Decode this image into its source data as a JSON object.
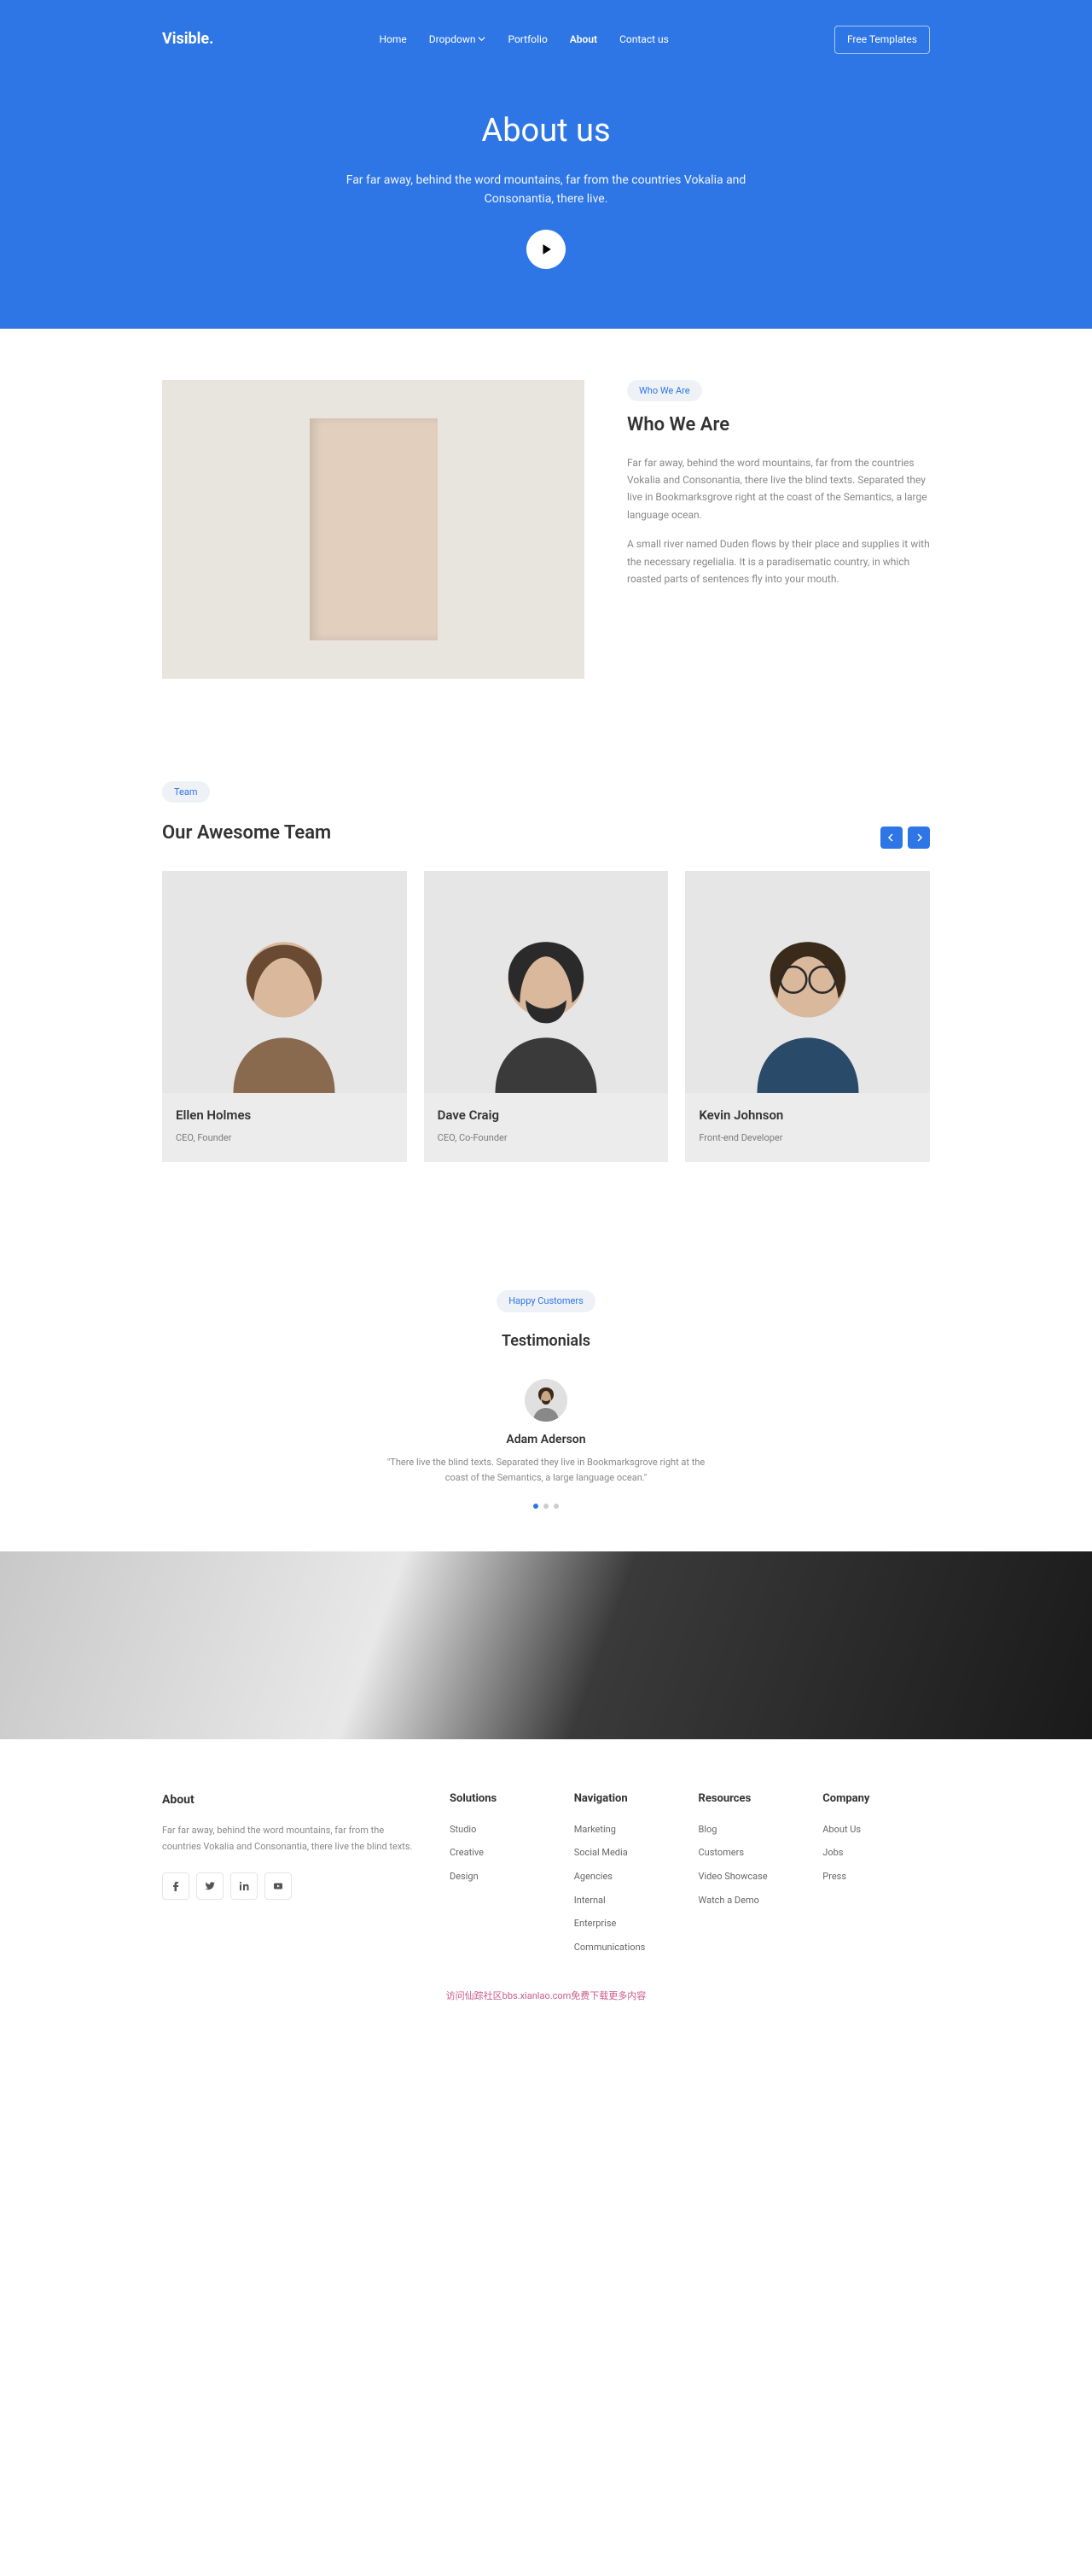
{
  "nav": {
    "logo": "Visible.",
    "items": [
      "Home",
      "Dropdown",
      "Portfolio",
      "About",
      "Contact us"
    ],
    "free": "Free Templates"
  },
  "hero": {
    "title": "About us",
    "subtitle": "Far far away, behind the word mountains, far from the countries Vokalia and Consonantia, there live."
  },
  "who": {
    "pill": "Who We Are",
    "title": "Who We Are",
    "p1": "Far far away, behind the word mountains, far from the countries Vokalia and Consonantia, there live the blind texts. Separated they live in Bookmarksgrove right at the coast of the Semantics, a large language ocean.",
    "p2": "A small river named Duden flows by their place and supplies it with the necessary regelialia. It is a paradisematic country, in which roasted parts of sentences fly into your mouth."
  },
  "team": {
    "pill": "Team",
    "title": "Our Awesome Team",
    "members": [
      {
        "name": "Ellen Holmes",
        "role": "CEO, Founder"
      },
      {
        "name": "Dave Craig",
        "role": "CEO, Co-Founder"
      },
      {
        "name": "Kevin Johnson",
        "role": "Front-end Developer"
      }
    ]
  },
  "testimonials": {
    "pill": "Happy Customers",
    "title": "Testimonials",
    "name": "Adam Aderson",
    "quote": "\"There live the blind texts. Separated they live in Bookmarksgrove right at the coast of the Semantics, a large language ocean.\""
  },
  "footer": {
    "about": {
      "title": "About",
      "text": "Far far away, behind the word mountains, far from the countries Vokalia and Consonantia, there live the blind texts."
    },
    "columns": [
      {
        "title": "Solutions",
        "links": [
          "Studio",
          "Creative",
          "Design"
        ]
      },
      {
        "title": "Navigation",
        "links": [
          "Marketing",
          "Social Media",
          "Agencies",
          "Internal",
          "Enterprise",
          "Communications"
        ]
      },
      {
        "title": "Resources",
        "links": [
          "Blog",
          "Customers",
          "Video Showcase",
          "Watch a Demo"
        ]
      },
      {
        "title": "Company",
        "links": [
          "About Us",
          "Jobs",
          "Press"
        ]
      }
    ],
    "bottom": "访问仙踪社区bbs.xianlao.com免费下载更多内容"
  }
}
